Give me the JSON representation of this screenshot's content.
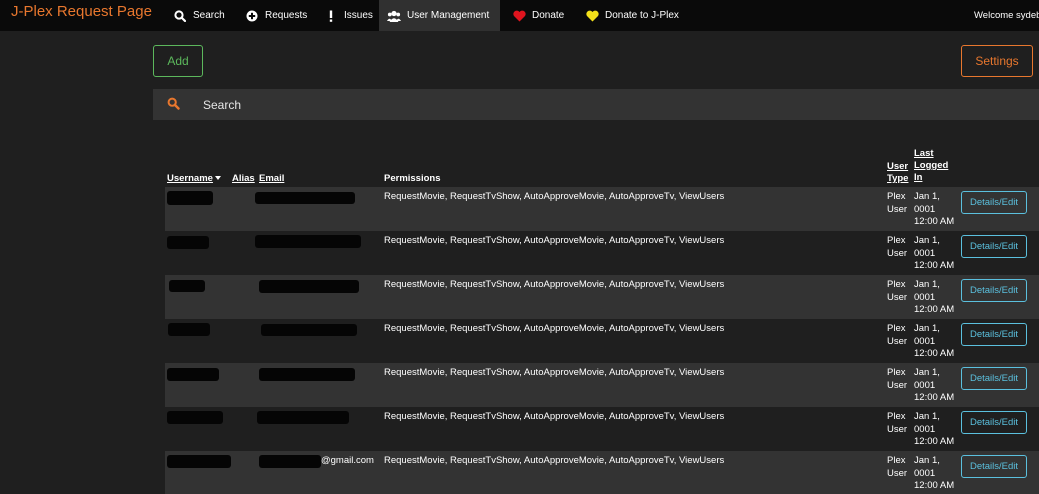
{
  "navbar": {
    "brand": "J-Plex Request Page",
    "items": [
      {
        "label": "Search",
        "icon": "search-icon"
      },
      {
        "label": "Requests",
        "icon": "plus-circle-icon"
      },
      {
        "label": "Issues",
        "icon": "exclamation-icon"
      },
      {
        "label": "User Management",
        "icon": "users-icon",
        "active": true
      },
      {
        "label": "Donate",
        "icon": "heart-icon"
      },
      {
        "label": "Donate to J-Plex",
        "icon": "heart-icon"
      }
    ],
    "welcome": "Welcome sydeb"
  },
  "toolbar": {
    "add_label": "Add",
    "settings_label": "Settings"
  },
  "search": {
    "placeholder": "Search"
  },
  "table": {
    "headers": {
      "username": "Username",
      "alias": "Alias",
      "email": "Email",
      "permissions": "Permissions",
      "user_type_1": "User",
      "user_type_2": "Type",
      "last_1": "Last",
      "last_2": "Logged",
      "last_3": "In"
    },
    "rows": [
      {
        "email": "",
        "permissions": "RequestMovie, RequestTvShow, AutoApproveMovie, AutoApproveTv, ViewUsers",
        "type_1": "Plex",
        "type_2": "User",
        "last_1": "Jan 1,",
        "last_2": "0001",
        "last_3": "12:00 AM",
        "button": "Details/Edit"
      },
      {
        "email": "",
        "permissions": "RequestMovie, RequestTvShow, AutoApproveMovie, AutoApproveTv, ViewUsers",
        "type_1": "Plex",
        "type_2": "User",
        "last_1": "Jan 1,",
        "last_2": "0001",
        "last_3": "12:00 AM",
        "button": "Details/Edit"
      },
      {
        "email": "",
        "permissions": "RequestMovie, RequestTvShow, AutoApproveMovie, AutoApproveTv, ViewUsers",
        "type_1": "Plex",
        "type_2": "User",
        "last_1": "Jan 1,",
        "last_2": "0001",
        "last_3": "12:00 AM",
        "button": "Details/Edit"
      },
      {
        "email": "",
        "permissions": "RequestMovie, RequestTvShow, AutoApproveMovie, AutoApproveTv, ViewUsers",
        "type_1": "Plex",
        "type_2": "User",
        "last_1": "Jan 1,",
        "last_2": "0001",
        "last_3": "12:00 AM",
        "button": "Details/Edit"
      },
      {
        "email": "",
        "permissions": "RequestMovie, RequestTvShow, AutoApproveMovie, AutoApproveTv, ViewUsers",
        "type_1": "Plex",
        "type_2": "User",
        "last_1": "Jan 1,",
        "last_2": "0001",
        "last_3": "12:00 AM",
        "button": "Details/Edit"
      },
      {
        "email": "",
        "permissions": "RequestMovie, RequestTvShow, AutoApproveMovie, AutoApproveTv, ViewUsers",
        "type_1": "Plex",
        "type_2": "User",
        "last_1": "Jan 1,",
        "last_2": "0001",
        "last_3": "12:00 AM",
        "button": "Details/Edit"
      },
      {
        "email": "@gmail.com",
        "permissions": "RequestMovie, RequestTvShow, AutoApproveMovie, AutoApproveTv, ViewUsers",
        "type_1": "Plex",
        "type_2": "User",
        "last_1": "Jan 1,",
        "last_2": "0001",
        "last_3": "12:00 AM",
        "button": "Details/Edit"
      }
    ]
  },
  "colors": {
    "brand": "#e8772e",
    "add": "#5cb85c",
    "settings": "#e8772e",
    "details": "#5bc0de",
    "navbar": "#0a0a0a",
    "background": "#1f1f1f",
    "stripe": "#333333"
  }
}
